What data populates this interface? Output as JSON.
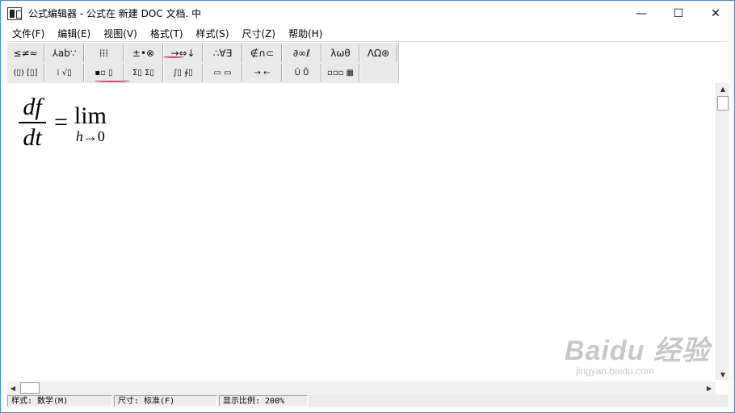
{
  "window": {
    "title": "公式编辑器 - 公式在 新建 DOC 文档. 中",
    "controls": {
      "minimize": "—",
      "maximize": "☐",
      "close": "✕"
    }
  },
  "menu": {
    "items": [
      "文件(F)",
      "编辑(E)",
      "视图(V)",
      "格式(T)",
      "样式(S)",
      "尺寸(Z)",
      "帮助(H)"
    ]
  },
  "toolbar": {
    "row1": [
      "≤≠≈",
      "⅄ab∵",
      "⁞⁞⁞",
      "±•⊗",
      "→⇔↓",
      "∴∀∃",
      "∉∩⊂",
      "∂∞ℓ",
      "λωθ",
      "ΛΩ⊛"
    ],
    "row2": [
      "(▯) [▯]",
      "⁞ √▯",
      "▪▫ ▯",
      "Σ▯ Σ▯",
      "∫▯ ∮▯",
      "▭ ▭",
      "→ ←",
      "Ū Ů",
      "▫▫▫ ▦"
    ]
  },
  "equation": {
    "numerator": "df",
    "denominator": "dt",
    "relation": "=",
    "operator": "lim",
    "subscript_var": "h",
    "subscript_arrow": "→",
    "subscript_limit": "0"
  },
  "scrollbars": {
    "up": "▲",
    "down": "▼",
    "left": "◀",
    "right": "▶"
  },
  "status": {
    "style": "样式: 数学(M)",
    "size": "尺寸: 标准(F)",
    "zoom": "显示比例: 200%"
  },
  "watermark": {
    "logo": "Baidu 经验",
    "url": "jingyan.baidu.com"
  },
  "colors": {
    "annotation_red": "#e04060",
    "toolbar_bg": "#e9e9e9",
    "window_border": "#3a8fd8"
  }
}
